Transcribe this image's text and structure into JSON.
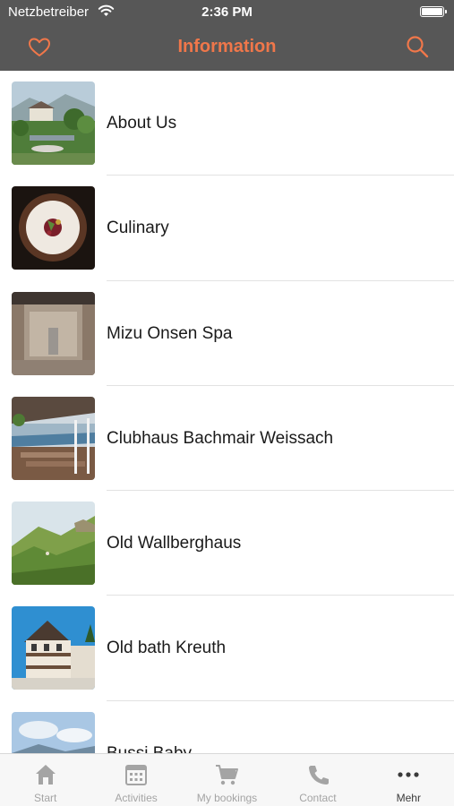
{
  "status_bar": {
    "carrier": "Netzbetreiber",
    "time": "2:36 PM"
  },
  "nav": {
    "title": "Information",
    "left_icon": "heart-icon",
    "right_icon": "search-icon",
    "accent_color": "#f0774a",
    "bar_color": "#575757"
  },
  "list": {
    "items": [
      {
        "label": "About Us"
      },
      {
        "label": "Culinary"
      },
      {
        "label": "Mizu Onsen Spa"
      },
      {
        "label": "Clubhaus Bachmair Weissach"
      },
      {
        "label": "Old Wallberghaus"
      },
      {
        "label": "Old bath Kreuth"
      },
      {
        "label": "Bussi Baby"
      }
    ]
  },
  "tabs": [
    {
      "label": "Start",
      "icon": "home-icon"
    },
    {
      "label": "Activities",
      "icon": "calendar-icon"
    },
    {
      "label": "My bookings",
      "icon": "cart-icon"
    },
    {
      "label": "Contact",
      "icon": "phone-icon"
    },
    {
      "label": "Mehr",
      "icon": "more-icon",
      "active": true
    }
  ]
}
